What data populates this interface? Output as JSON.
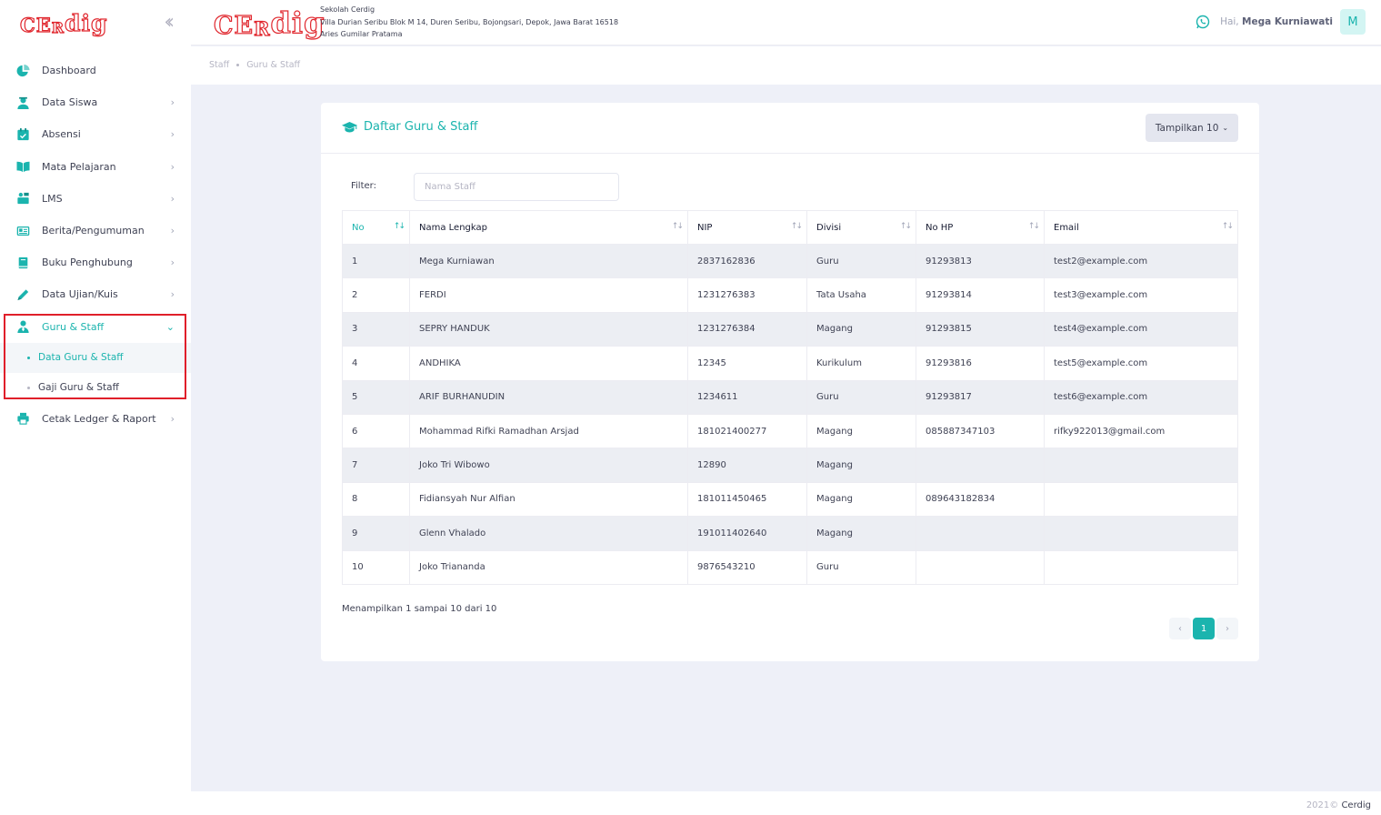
{
  "brand": {
    "logo_text": "CERdig"
  },
  "sidebar": {
    "items": [
      {
        "label": "Dashboard",
        "icon": "dashboard-icon"
      },
      {
        "label": "Data Siswa",
        "icon": "student-icon"
      },
      {
        "label": "Absensi",
        "icon": "calendar-check-icon"
      },
      {
        "label": "Mata Pelajaran",
        "icon": "book-open-icon"
      },
      {
        "label": "LMS",
        "icon": "lms-icon"
      },
      {
        "label": "Berita/Pengumuman",
        "icon": "newspaper-icon"
      },
      {
        "label": "Buku Penghubung",
        "icon": "book-icon"
      },
      {
        "label": "Data Ujian/Kuis",
        "icon": "pencil-icon"
      },
      {
        "label": "Guru & Staff",
        "icon": "user-tie-icon"
      },
      {
        "label": "Cetak Ledger & Raport",
        "icon": "print-icon"
      }
    ],
    "submenu": [
      {
        "label": "Data Guru & Staff"
      },
      {
        "label": "Gaji Guru & Staff"
      }
    ]
  },
  "header": {
    "school_name": "Sekolah Cerdig",
    "address": "Villa Durian Seribu Blok M 14, Duren Seribu, Bojongsari, Depok, Jawa Barat 16518",
    "principal": "Aries Gumilar Pratama",
    "greeting": "Hai,",
    "user_name": "Mega Kurniawati",
    "avatar_letter": "M"
  },
  "breadcrumb": [
    "Staff",
    "Guru & Staff"
  ],
  "card": {
    "title": "Daftar Guru & Staff",
    "show_label": "Tampilkan 10",
    "filter_label": "Filter:",
    "filter_placeholder": "Nama Staff",
    "filter_value": ""
  },
  "table": {
    "columns": [
      "No",
      "Nama Lengkap",
      "NIP",
      "Divisi",
      "No HP",
      "Email"
    ],
    "rows": [
      [
        "1",
        "Mega Kurniawan",
        "2837162836",
        "Guru",
        "91293813",
        "test2@example.com"
      ],
      [
        "2",
        "FERDI",
        "1231276383",
        "Tata Usaha",
        "91293814",
        "test3@example.com"
      ],
      [
        "3",
        "SEPRY HANDUK",
        "1231276384",
        "Magang",
        "91293815",
        "test4@example.com"
      ],
      [
        "4",
        "ANDHIKA",
        "12345",
        "Kurikulum",
        "91293816",
        "test5@example.com"
      ],
      [
        "5",
        "ARIF BURHANUDIN",
        "1234611",
        "Guru",
        "91293817",
        "test6@example.com"
      ],
      [
        "6",
        "Mohammad Rifki Ramadhan Arsjad",
        "181021400277",
        "Magang",
        "085887347103",
        "rifky922013@gmail.com"
      ],
      [
        "7",
        "Joko Tri Wibowo",
        "12890",
        "Magang",
        "",
        ""
      ],
      [
        "8",
        "Fidiansyah Nur Alfian",
        "181011450465",
        "Magang",
        "089643182834",
        ""
      ],
      [
        "9",
        "Glenn Vhalado",
        "191011402640",
        "Magang",
        "",
        ""
      ],
      [
        "10",
        "Joko Triananda",
        "9876543210",
        "Guru",
        "",
        ""
      ]
    ]
  },
  "info": "Menampilkan 1 sampai 10 dari 10",
  "pagination": {
    "prev": "‹",
    "current": "1",
    "next": "›"
  },
  "footer": {
    "year": "2021©",
    "brand": "Cerdig"
  },
  "colors": {
    "accent": "#1bb4ae",
    "brand_red": "#e0262d",
    "highlight": "#e01f2a"
  }
}
